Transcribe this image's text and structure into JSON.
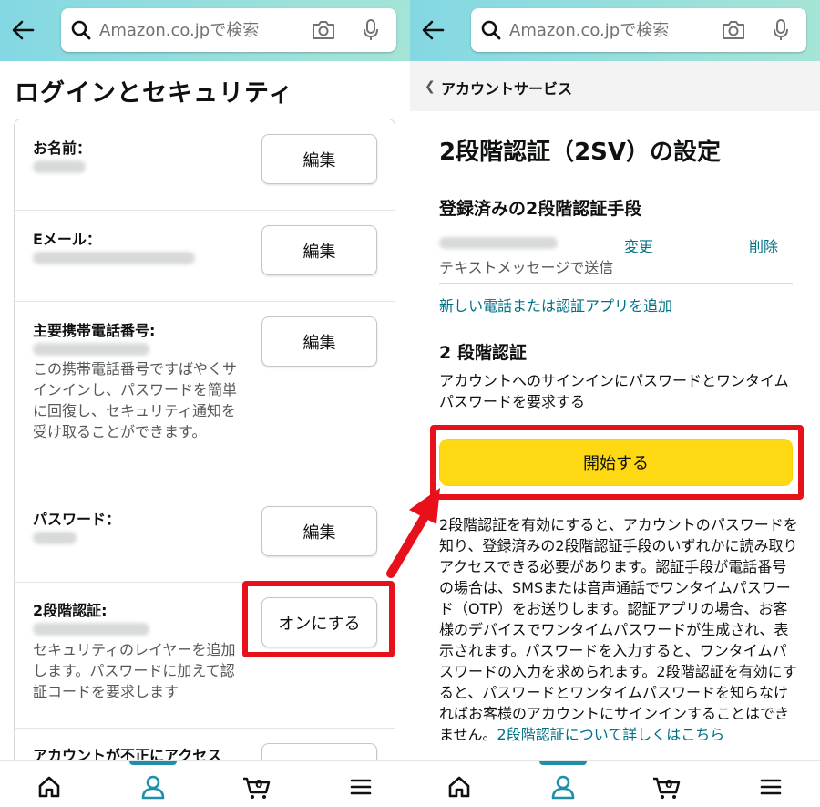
{
  "search": {
    "placeholder": "Amazon.co.jpで検索"
  },
  "left": {
    "page_title": "ログインとセキュリティ",
    "rows": [
      {
        "label": "お名前：",
        "button": "編集"
      },
      {
        "label": "Eメール：",
        "button": "編集"
      },
      {
        "label": "主要携帯電話番号:",
        "description": "この携帯電話番号ですばやくサインインし、パスワードを簡単に回復し、セキュリティ通知を受け取ることができます。",
        "button": "編集"
      },
      {
        "label": "パスワード：",
        "button": "編集"
      },
      {
        "label": "2段階認証:",
        "description": "セキュリティのレイヤーを追加します。パスワードに加えて認証コードを要求します",
        "button": "オンにする"
      },
      {
        "label": "アカウントが不正にアクセス",
        "button": ""
      }
    ]
  },
  "right": {
    "breadcrumb": "アカウントサービス",
    "title": "2段階認証（2SV）の設定",
    "registered_heading": "登録済みの2段階認証手段",
    "change_link": "変更",
    "delete_link": "削除",
    "method_note": "テキストメッセージで送信",
    "add_link": "新しい電話または認証アプリを追加",
    "section_heading": "2 段階認証",
    "section_desc": "アカウントへのサインインにパスワードとワンタイムパスワードを要求する",
    "start_button": "開始する",
    "long_text": "2段階認証を有効にすると、アカウントのパスワードを知り、登録済みの2段階認証手段のいずれかに読み取りアクセスできる必要があります。認証手段が電話番号の場合は、SMSまたは音声通話でワンタイムパスワード（OTP）をお送りします。認証アプリの場合、お客様のデバイスでワンタイムパスワードが生成され、表示されます。パスワードを入力すると、ワンタイムパスワードの入力を求められます。2段階認証を有効にすると、パスワードとワンタイムパスワードを知らなければお客様のアカウントにサインインすることはできません。",
    "learn_more_link": "2段階認証について詳しくはこちら"
  },
  "nav": {
    "items": [
      "home-icon",
      "account-icon",
      "cart-icon",
      "menu-icon"
    ],
    "cart_count": "0"
  },
  "colors": {
    "accent": "#1f8fa8",
    "link": "#007185",
    "button_yellow": "#ffd814",
    "highlight_red": "#e8101a"
  }
}
